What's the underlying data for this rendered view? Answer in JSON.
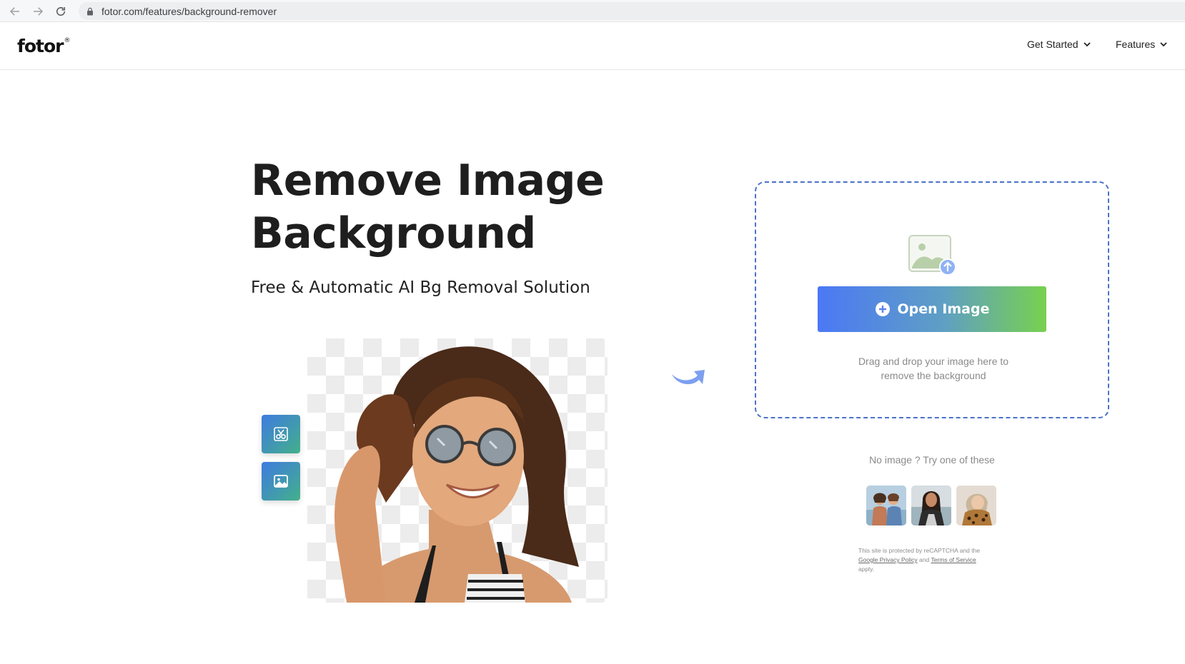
{
  "browser": {
    "url": "fotor.com/features/background-remover"
  },
  "header": {
    "logo_text": "fotor",
    "logo_mark": "®",
    "nav": [
      {
        "label": "Get Started"
      },
      {
        "label": "Features"
      }
    ]
  },
  "hero": {
    "title_line1": "Remove Image",
    "title_line2": "Background",
    "subtitle": "Free & Automatic AI Bg Removal Solution"
  },
  "upload": {
    "button_label": "Open Image",
    "hint_line1": "Drag and drop your image here to",
    "hint_line2": "remove the background"
  },
  "samples": {
    "prompt": "No image ?  Try one of these",
    "items": [
      {
        "name": "sample-two-people"
      },
      {
        "name": "sample-woman-beach"
      },
      {
        "name": "sample-person-leopard-print"
      }
    ]
  },
  "legal": {
    "text_before": "This site is protected by reCAPTCHA and the",
    "privacy_link": "Google Privacy Policy",
    "and_word": "and",
    "terms_link": "Terms of Service",
    "text_after": "apply."
  },
  "colors": {
    "upload_border": "#4a72c6",
    "button_gradient_start": "#4b78f5",
    "button_gradient_end": "#78d14e",
    "tool_button_start": "#3f7be0",
    "tool_button_end": "#43b08a"
  },
  "icons": {
    "back": "arrow-left-icon",
    "forward": "arrow-right-icon",
    "reload": "reload-icon",
    "lock": "lock-icon",
    "chevron": "chevron-down-icon",
    "cutout": "scissors-cutout-icon",
    "image": "image-icon",
    "upload": "image-upload-icon",
    "plus": "plus-circle-icon",
    "arrow": "curved-arrow-icon"
  }
}
